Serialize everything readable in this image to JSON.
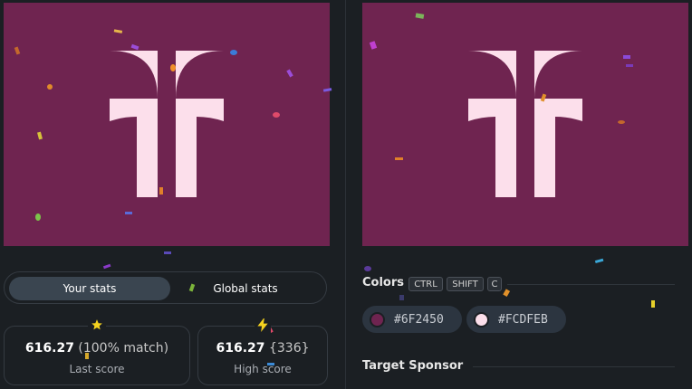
{
  "colors": {
    "background": "#6f2450",
    "shape": "#fcdfeb"
  },
  "stats_toggle": {
    "your_stats": "Your stats",
    "global_stats": "Global stats",
    "selected": "Your stats"
  },
  "last_score": {
    "icon": "star-icon",
    "value": "616.27",
    "detail": "(100% match)",
    "label": "Last score"
  },
  "high_score": {
    "icon": "lightning-icon",
    "value": "616.27",
    "detail": "{336}",
    "label": "High score"
  },
  "colors_section": {
    "title": "Colors",
    "shortcut": [
      "CTRL",
      "SHIFT",
      "C"
    ],
    "swatches": [
      {
        "hex": "#6F2450"
      },
      {
        "hex": "#FCDFEB"
      }
    ]
  },
  "sponsor_section": {
    "title": "Target Sponsor"
  }
}
